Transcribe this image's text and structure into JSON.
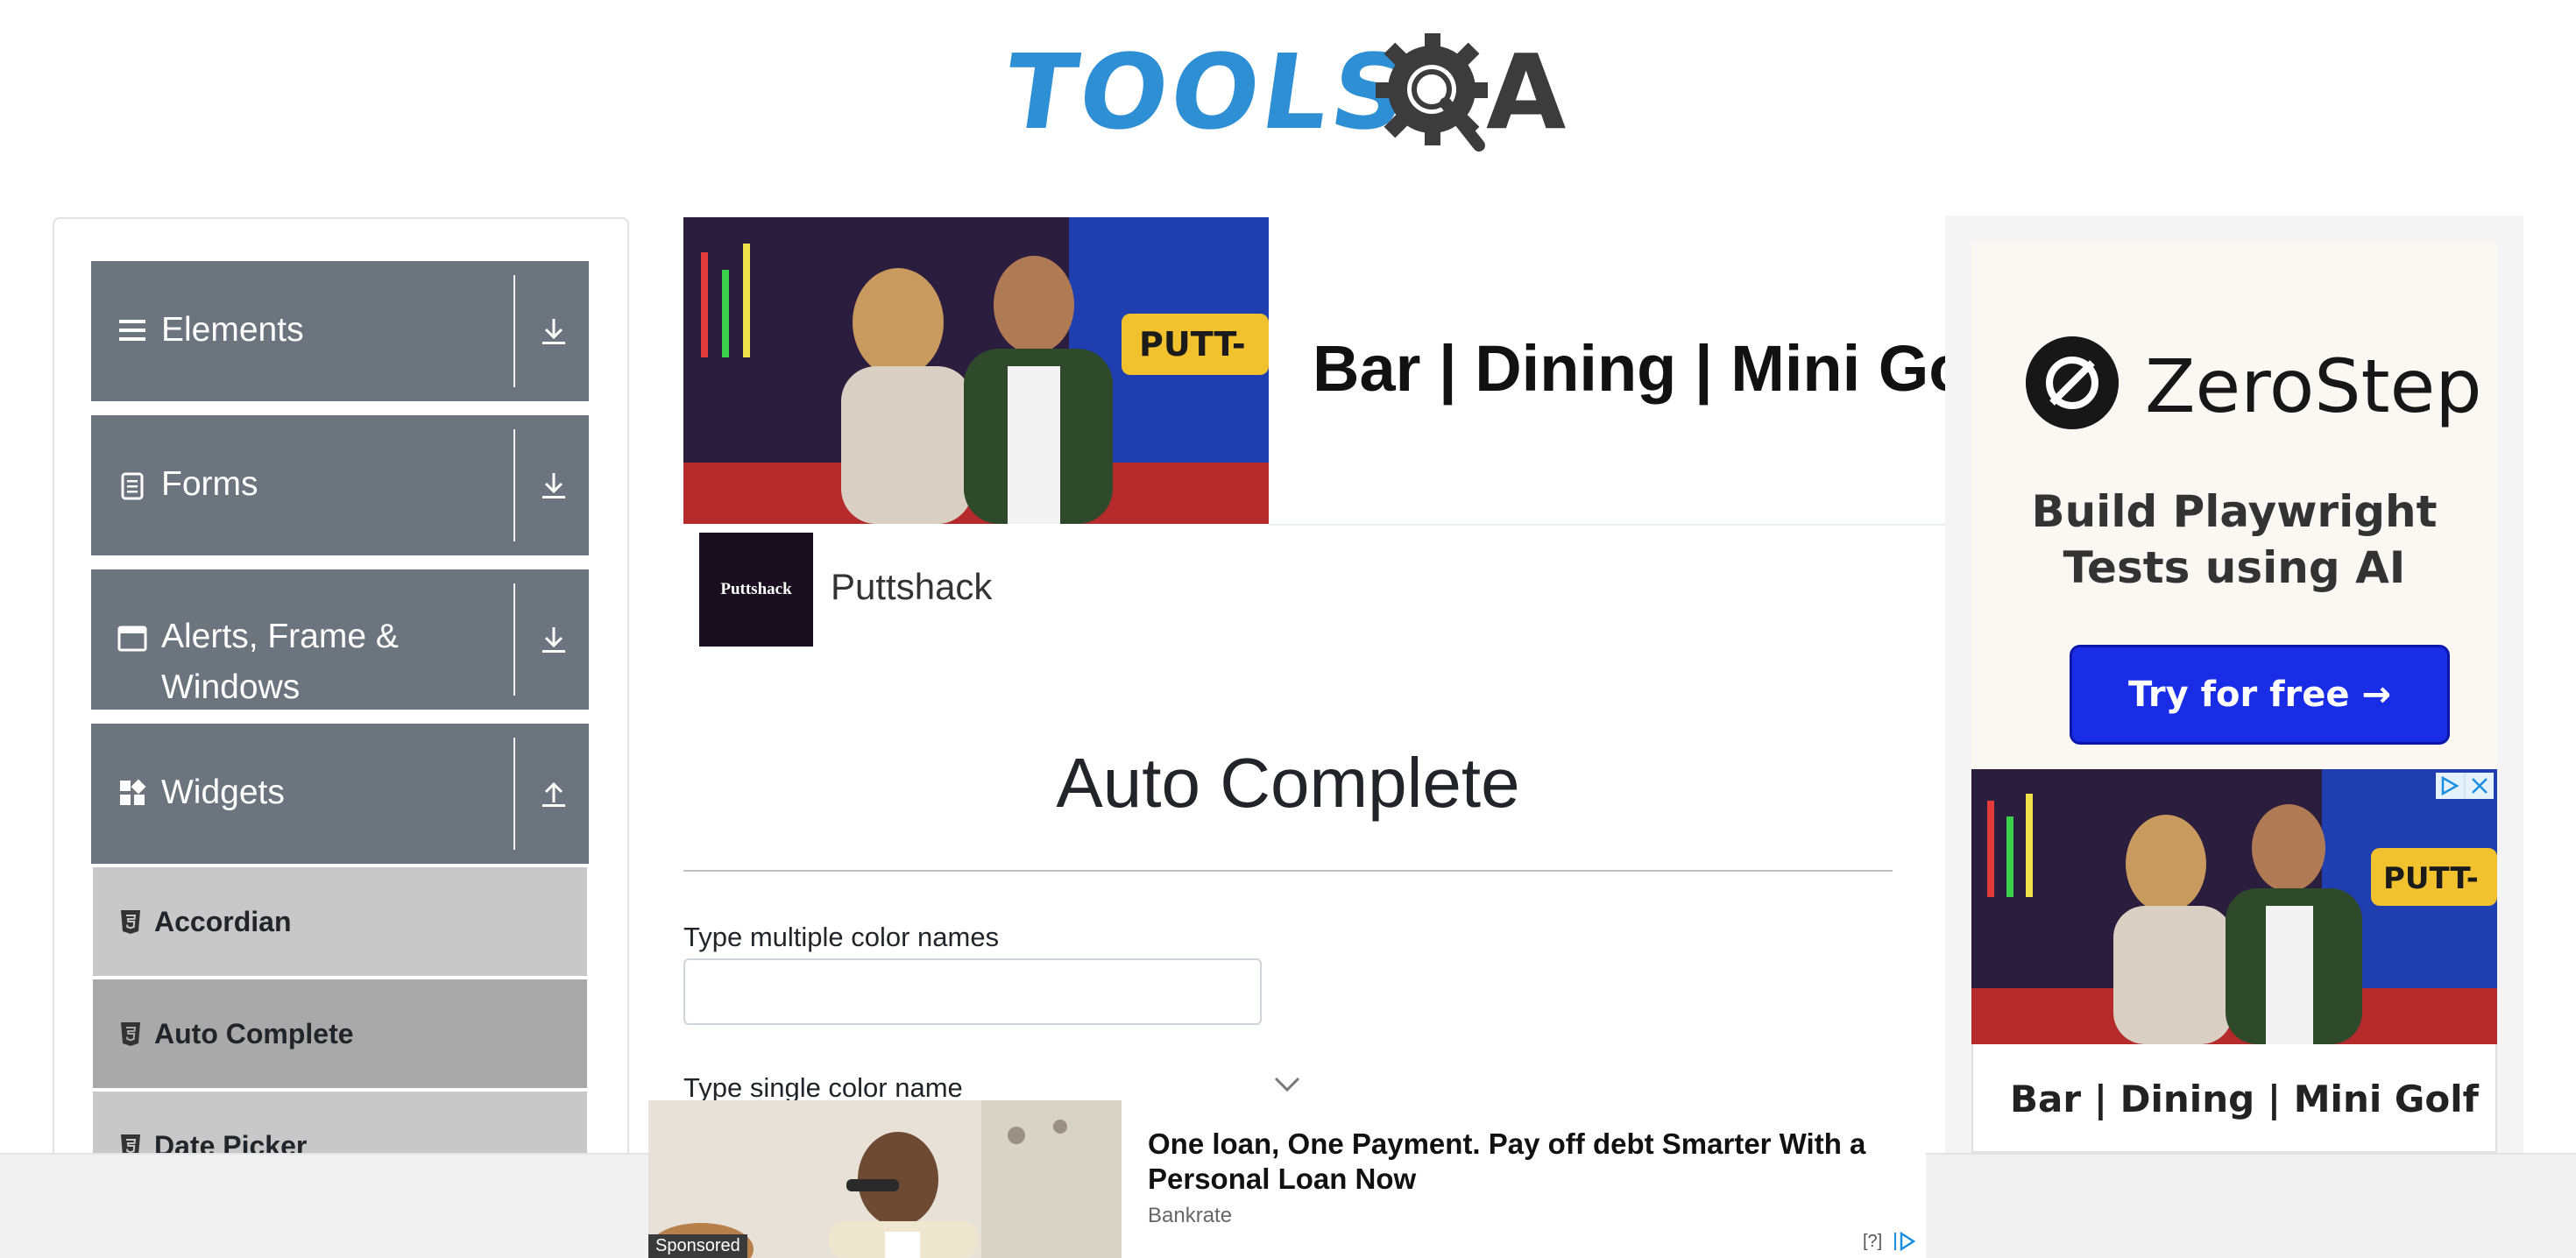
{
  "header": {
    "logo_text_primary": "TOOLS",
    "logo_text_secondary": "A"
  },
  "sidebar": {
    "groups": [
      {
        "title": "Elements",
        "icon": "list-icon",
        "toggle": "download-icon"
      },
      {
        "title": "Forms",
        "icon": "document-icon",
        "toggle": "download-icon"
      },
      {
        "title": "Alerts, Frame & Windows",
        "icon": "window-icon",
        "toggle": "download-icon"
      },
      {
        "title": "Widgets",
        "icon": "widgets-icon",
        "toggle": "upload-icon"
      }
    ],
    "widget_items": [
      {
        "label": "Accordian",
        "icon": "html5-icon",
        "active": false
      },
      {
        "label": "Auto Complete",
        "icon": "html5-icon",
        "active": true
      },
      {
        "label": "Date Picker",
        "icon": "html5-icon",
        "active": false
      }
    ]
  },
  "ad_top": {
    "headline": "Bar | Dining | Mini Golf",
    "brand_logo_text": "Puttshack",
    "brand_name": "Puttshack",
    "sign_text": "PUTT-"
  },
  "main": {
    "title": "Auto Complete",
    "multi_label": "Type multiple color names",
    "multi_value": "",
    "single_label": "Type single color name"
  },
  "ad_right": {
    "brand": "ZeroStep",
    "tagline": "Build Playwright Tests using AI",
    "cta": "Try for free →",
    "headline": "Bar | Dining | Mini Golf",
    "sign_text": "PUTT-"
  },
  "bottom_ad": {
    "headline": "One loan, One Payment. Pay off debt Smarter With a Personal Loan Now",
    "source": "Bankrate",
    "sponsored": "Sponsored",
    "help": "[?]"
  },
  "colors": {
    "logo_blue": "#2e8fd4",
    "sidebar_group_bg": "#6c757d",
    "sidebar_item_bg": "#c8c8c8",
    "sidebar_item_active_bg": "#a9a9a9",
    "cta_blue": "#1a2de6"
  }
}
